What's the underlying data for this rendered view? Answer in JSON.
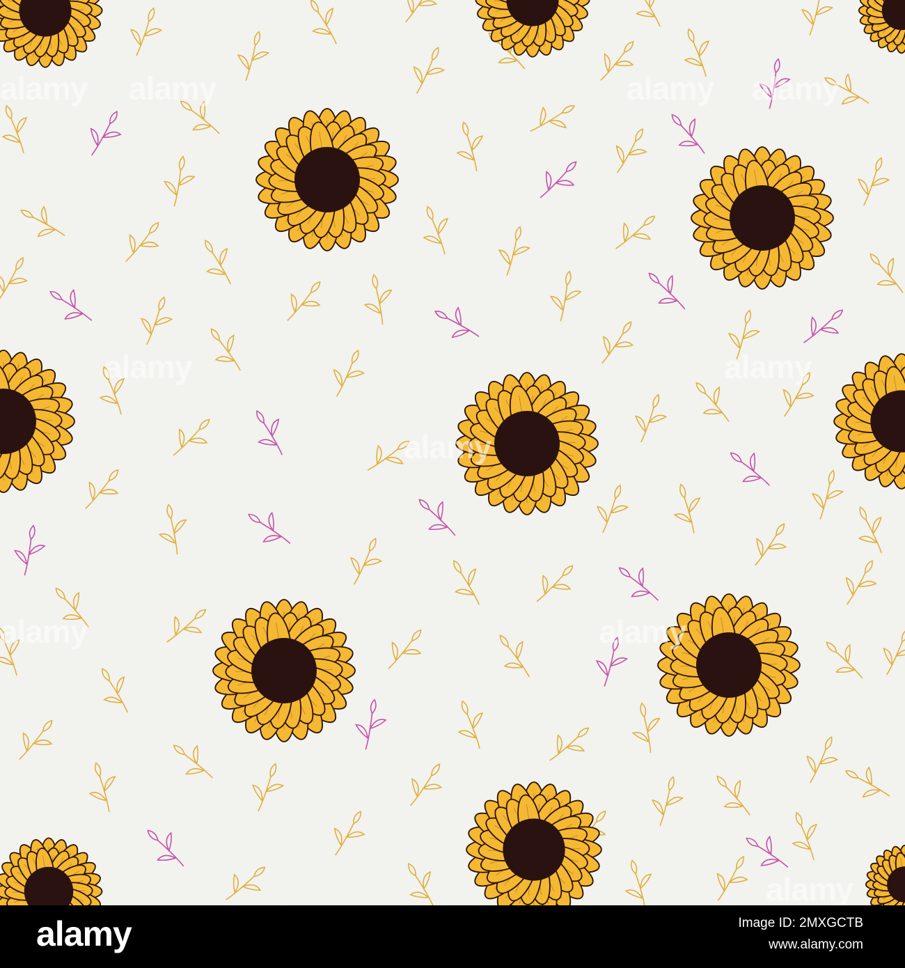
{
  "watermark": {
    "text": "alamy"
  },
  "footer": {
    "logo": "alamy",
    "image_id": "Image ID: 2MXGCTB",
    "url": "www.alamy.com"
  },
  "colors": {
    "background": "#f2f2ee",
    "petal": "#f5b833",
    "petal_outline": "#2a1206",
    "center": "#2a1210",
    "sprig_gold": "#e0b040",
    "sprig_pink": "#c452a8",
    "footer_bg": "#000000"
  }
}
